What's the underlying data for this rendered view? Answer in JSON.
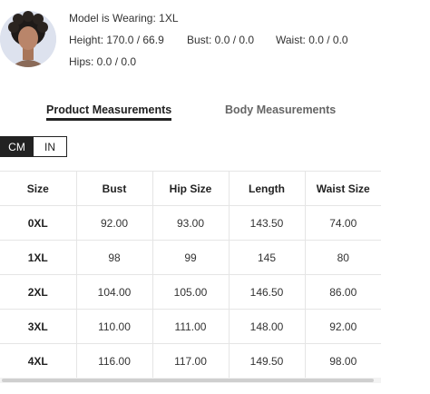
{
  "model": {
    "wearing_label": "Model is Wearing: 1XL",
    "height": "Height: 170.0 / 66.9",
    "bust": "Bust: 0.0 / 0.0",
    "waist": "Waist: 0.0 / 0.0",
    "hips": "Hips: 0.0 / 0.0"
  },
  "tabs": [
    {
      "label": "Product Measurements",
      "active": true
    },
    {
      "label": "Body Measurements",
      "active": false
    }
  ],
  "units": [
    {
      "label": "CM",
      "active": true
    },
    {
      "label": "IN",
      "active": false
    }
  ],
  "table": {
    "headers": [
      "Size",
      "Bust",
      "Hip Size",
      "Length",
      "Waist Size"
    ],
    "rows": [
      [
        "0XL",
        "92.00",
        "93.00",
        "143.50",
        "74.00"
      ],
      [
        "1XL",
        "98",
        "99",
        "145",
        "80"
      ],
      [
        "2XL",
        "104.00",
        "105.00",
        "146.50",
        "86.00"
      ],
      [
        "3XL",
        "110.00",
        "111.00",
        "148.00",
        "92.00"
      ],
      [
        "4XL",
        "116.00",
        "117.00",
        "149.50",
        "98.00"
      ]
    ]
  },
  "colors": {
    "accent": "#222222",
    "inactive_tab": "#666666",
    "grid": "#e5e5e5"
  }
}
